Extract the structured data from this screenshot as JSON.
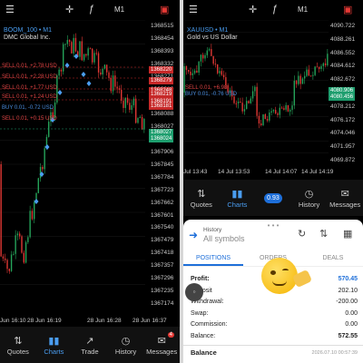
{
  "left": {
    "toolbar": {
      "timeframe": "M1"
    },
    "symbol": "BOOM_100 • M1",
    "broker": "DMC Global Inc.",
    "price_levels": [
      "1368515",
      "1368454",
      "1368393",
      "1368332",
      "1368271",
      "1368210",
      "1368149",
      "1368088",
      "1368027",
      "1367966",
      "1367906",
      "1367845",
      "1367784",
      "1367723",
      "1367662",
      "1367601",
      "1367540",
      "1367479",
      "1367418",
      "1367357",
      "1367296",
      "1367235",
      "1367174"
    ],
    "tags": [
      {
        "label": "1368220",
        "color": "#c62828"
      },
      {
        "label": "1368279",
        "color": "#c62828"
      },
      {
        "label": "1368248",
        "color": "#c62828"
      },
      {
        "label": "1368219",
        "color": "#c62828"
      },
      {
        "label": "1368191",
        "color": "#c62828"
      },
      {
        "label": "1368181",
        "color": "#c62828"
      },
      {
        "label": "1368027",
        "color": "#1e9e6e"
      },
      {
        "label": "1368024",
        "color": "#1e9e6e"
      }
    ],
    "tickets": [
      {
        "text": "SELL 0.01, +2.78 USD",
        "type": "sell"
      },
      {
        "text": "SELL 0.01, +2.28 USD",
        "type": "sell"
      },
      {
        "text": "SELL 0.01, +1.77 USD",
        "type": "sell"
      },
      {
        "text": "SELL 0.01, +1.24 USD",
        "type": "sell"
      },
      {
        "text": "BUY 0.01, -0.72 USD",
        "type": "buy"
      },
      {
        "text": "SELL 0.01, +0.15 USD",
        "type": "sell"
      }
    ],
    "time_labels": [
      "Jun 16:10",
      "28 Jun 16:19",
      "28 Jun 16:28",
      "28 Jun 16:37"
    ],
    "nav": [
      {
        "label": "Quotes",
        "icon": "⇅"
      },
      {
        "label": "Charts",
        "icon": "▮▮"
      },
      {
        "label": "Trade",
        "icon": "↗"
      },
      {
        "label": "History",
        "icon": "◷"
      },
      {
        "label": "Messages",
        "icon": "✉"
      }
    ],
    "messages_badge": "4"
  },
  "right": {
    "toolbar": {
      "timeframe": "M1"
    },
    "symbol": "XAUUSD • M1",
    "desc": "Gold vs US Dollar",
    "price_levels": [
      "4090.722",
      "4088.261",
      "4086.552",
      "4084.612",
      "4082.672",
      "4080.486",
      "4078.212",
      "4076.172",
      "4074.046",
      "4071.957",
      "4069.872"
    ],
    "tags": [
      {
        "label": "4080.906",
        "color": "#1e9e6e"
      },
      {
        "label": "4080.456",
        "color": "#1e9e6e"
      }
    ],
    "tickets": [
      {
        "text": "SELL 0.01, +6.98",
        "type": "sell"
      },
      {
        "text": "BUY 0.01, -0.76 USD",
        "type": "buy"
      }
    ],
    "time_labels": [
      "Jul 13:43",
      "14 Jul 13:53",
      "14 Jul 14:07",
      "14 Jul 14:19"
    ],
    "nav": [
      {
        "label": "Quotes",
        "icon": "⇅"
      },
      {
        "label": "Charts",
        "icon": "▮▮"
      },
      {
        "label": "",
        "icon": "0.93"
      },
      {
        "label": "History",
        "icon": "◷"
      },
      {
        "label": "Messages",
        "icon": "✉"
      }
    ],
    "history": {
      "title": "History",
      "subtitle": "All symbols",
      "tabs": [
        "POSITIONS",
        "ORDERS",
        "DEALS"
      ],
      "rows": [
        {
          "label": "Profit:",
          "value": "570.45"
        },
        {
          "label": "Deposit",
          "value": "202.10"
        },
        {
          "label": "Withdrawal:",
          "value": "-200.00"
        },
        {
          "label": "Swap:",
          "value": "0.00"
        },
        {
          "label": "Commission:",
          "value": "0.00"
        },
        {
          "label": "Balance:",
          "value": "572.55"
        }
      ],
      "footer_label": "Balance",
      "footer_time": "2026.07.10 00:57:39"
    }
  }
}
